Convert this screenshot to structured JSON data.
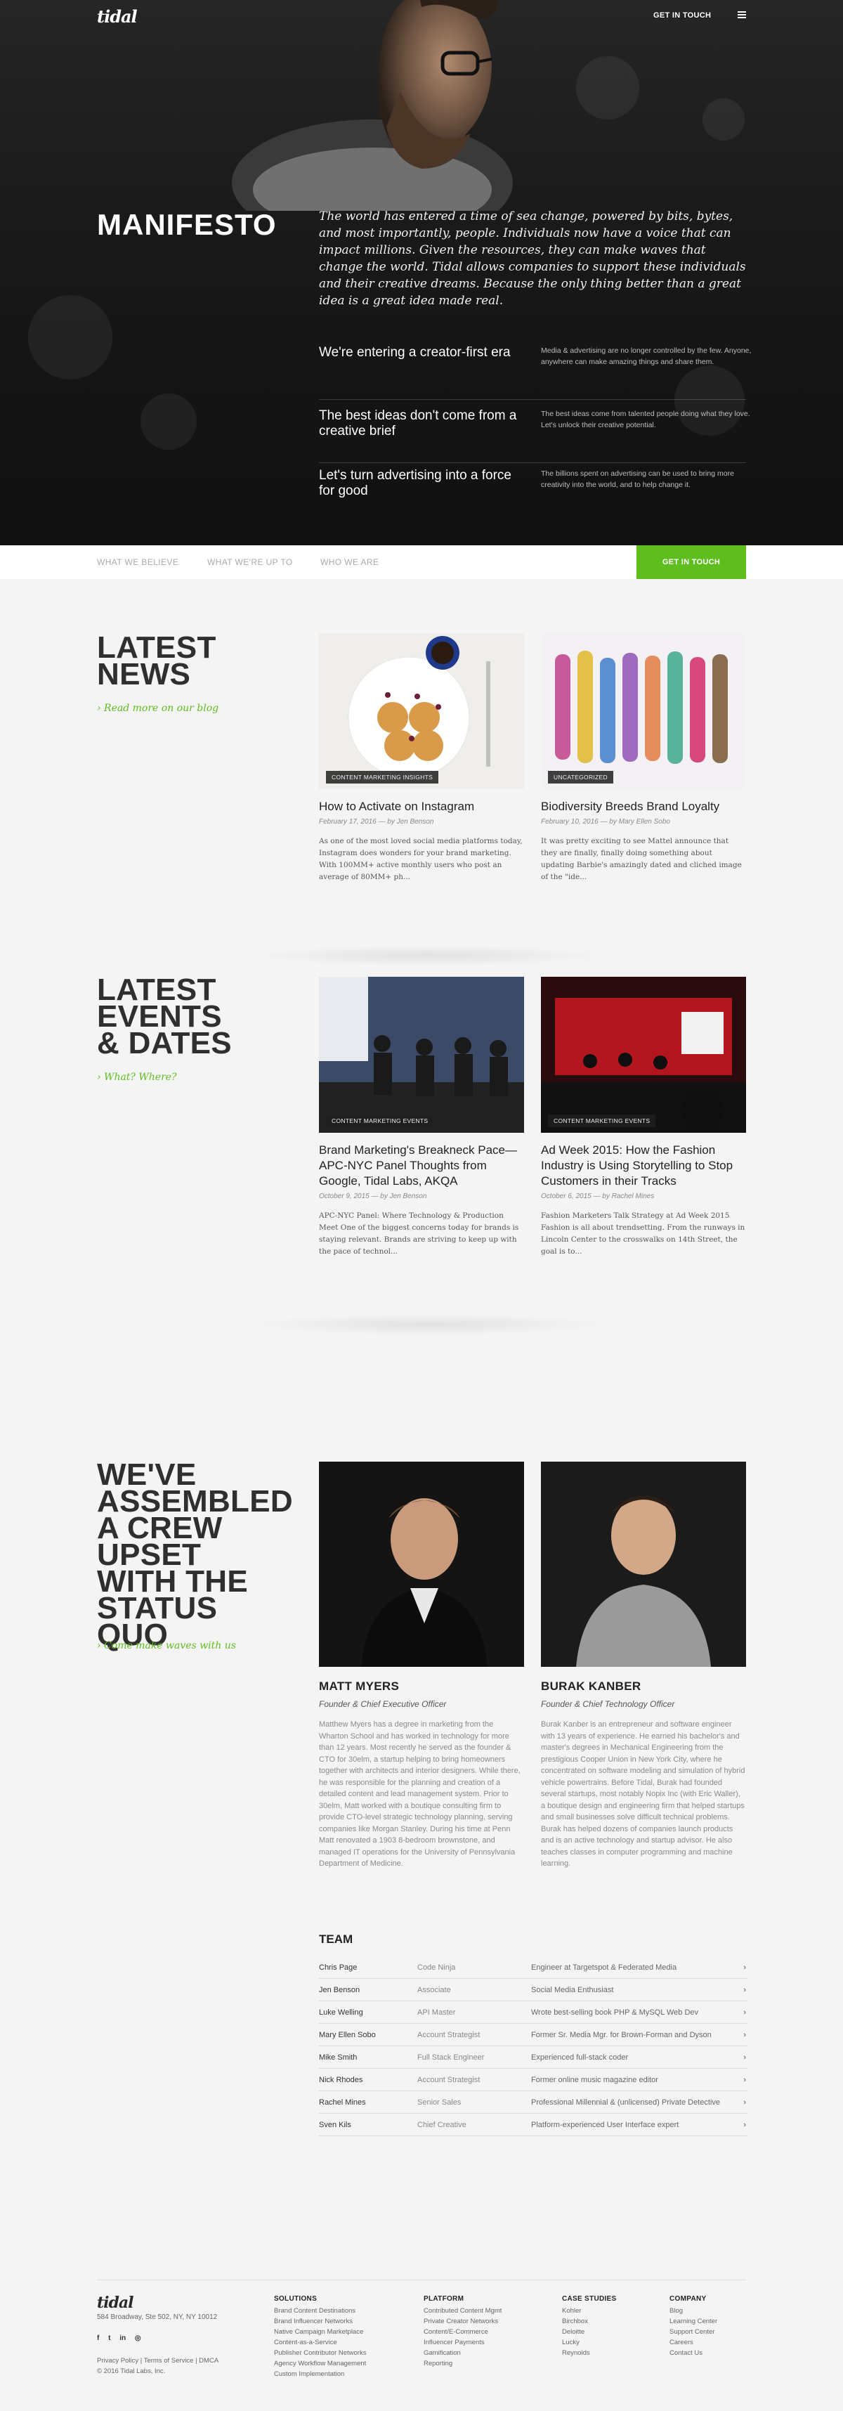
{
  "header": {
    "logo": "tidal",
    "cta": "GET IN TOUCH"
  },
  "manifesto": {
    "title": "MANIFESTO",
    "text": "The world has entered a time of sea change, powered by bits, bytes, and most importantly, people. Individuals now have a voice that can impact millions. Given the resources, they can make waves that change the world. Tidal allows companies to support these individuals and their creative dreams. Because the only thing better than a great idea is a great idea made real.",
    "beliefs": [
      {
        "title": "We're entering a creator-first era",
        "desc": "Media & advertising are no longer controlled by the few. Anyone, anywhere can make amazing things and share them."
      },
      {
        "title": "The best ideas don't come from a creative brief",
        "desc": "The best ideas come from talented people doing what they love. Let's unlock their creative potential."
      },
      {
        "title": "Let's turn advertising into a force for good",
        "desc": "The billions spent on advertising can be used to bring more creativity into the world, and to help change it."
      }
    ]
  },
  "subnav": {
    "items": [
      "WHAT WE BELIEVE",
      "WHAT WE'RE UP TO",
      "WHO WE ARE"
    ],
    "cta": "GET IN TOUCH"
  },
  "news": {
    "title": "LATEST NEWS",
    "link": "› Read more on our blog",
    "cards": [
      {
        "tag": "CONTENT MARKETING INSIGHTS",
        "title": "How to Activate on Instagram",
        "meta": "February 17, 2016 — by Jen Benson",
        "excerpt": "As one of the most loved social media platforms today, Instagram does wonders for your brand marketing. With 100MM+ active monthly users who post an average of 80MM+ ph..."
      },
      {
        "tag": "UNCATEGORIZED",
        "title": "Biodiversity Breeds Brand Loyalty",
        "meta": "February 10, 2016 — by Mary Ellen Sobo",
        "excerpt": "It was pretty exciting to see Mattel announce that they are finally, finally doing something about updating Barbie's amazingly dated and cliched image of the \"ide..."
      }
    ]
  },
  "events": {
    "title": "LATEST EVENTS & DATES",
    "link": "› What? Where?",
    "cards": [
      {
        "tag": "CONTENT MARKETING EVENTS",
        "title": "Brand Marketing's Breakneck Pace— APC-NYC Panel Thoughts from Google, Tidal Labs, AKQA",
        "meta": "October 9, 2015 — by Jen Benson",
        "excerpt": "APC-NYC Panel: Where Technology & Production Meet One of the biggest concerns today for brands is staying relevant. Brands are striving to keep up with the pace of technol..."
      },
      {
        "tag": "CONTENT MARKETING EVENTS",
        "title": "Ad Week 2015: How the Fashion Industry is Using Storytelling to Stop Customers in their Tracks",
        "meta": "October 6, 2015 — by Rachel Mines",
        "excerpt": "Fashion Marketers Talk Strategy at Ad Week 2015 Fashion is all about trendsetting. From the runways in Lincoln Center to the crosswalks on 14th Street, the goal is to..."
      }
    ]
  },
  "crew": {
    "title": "WE'VE ASSEMBLED A CREW UPSET WITH THE STATUS QUO",
    "link": "› Come make waves with us",
    "members": [
      {
        "name": "MATT MYERS",
        "role": "Founder & Chief Executive Officer",
        "bio": "Matthew Myers has a degree in marketing from the Wharton School and has worked in technology for more than 12 years. Most recently he served as the founder & CTO for 30elm, a startup helping to bring homeowners together with architects and interior designers. While there, he was responsible for the planning and creation of a detailed content and lead management system. Prior to 30elm, Matt worked with a boutique consulting firm to provide CTO-level strategic technology planning, serving companies like Morgan Stanley. During his time at Penn Matt renovated a 1903 8-bedroom brownstone, and managed IT operations for the University of Pennsylvania Department of Medicine."
      },
      {
        "name": "BURAK KANBER",
        "role": "Founder & Chief Technology Officer",
        "bio": "Burak Kanber is an entrepreneur and software engineer with 13 years of experience. He earned his bachelor's and master's degrees in Mechanical Engineering from the prestigious Cooper Union in New York City, where he concentrated on software modeling and simulation of hybrid vehicle powertrains. Before Tidal, Burak had founded several startups, most notably Nopix Inc (with Eric Waller), a boutique design and engineering firm that helped startups and small businesses solve difficult technical problems. Burak has helped dozens of companies launch products and is an active technology and startup advisor. He also teaches classes in computer programming and machine learning."
      }
    ]
  },
  "team": {
    "title": "TEAM",
    "rows": [
      {
        "name": "Chris Page",
        "role": "Code Ninja",
        "note": "Engineer at Targetspot & Federated Media"
      },
      {
        "name": "Jen Benson",
        "role": "Associate",
        "note": "Social Media Enthusiast"
      },
      {
        "name": "Luke Welling",
        "role": "API Master",
        "note": "Wrote best-selling book PHP & MySQL Web Dev"
      },
      {
        "name": "Mary Ellen Sobo",
        "role": "Account Strategist",
        "note": "Former Sr. Media Mgr. for Brown-Forman and Dyson"
      },
      {
        "name": "Mike Smith",
        "role": "Full Stack Engineer",
        "note": "Experienced full-stack coder"
      },
      {
        "name": "Nick Rhodes",
        "role": "Account Strategist",
        "note": "Former online music magazine editor"
      },
      {
        "name": "Rachel Mines",
        "role": "Senior Sales",
        "note": "Professional Millennial & (unlicensed) Private Detective"
      },
      {
        "name": "Sven Kils",
        "role": "Chief Creative",
        "note": "Platform-experienced User Interface expert"
      }
    ],
    "arrow": "›"
  },
  "footer": {
    "logo": "tidal",
    "address": "584 Broadway, Ste 502, NY, NY 10012",
    "social": [
      "f",
      "t",
      "in",
      "◎"
    ],
    "legal1": "Privacy Policy | Terms of Service | DMCA",
    "legal2": "© 2016 Tidal Labs, Inc.",
    "columns": [
      {
        "title": "SOLUTIONS",
        "links": [
          "Brand Content Destinations",
          "Brand Influencer Networks",
          "Native Campaign Marketplace",
          "Content-as-a-Service",
          "Publisher Contributor Networks",
          "Agency Workflow Management",
          "Custom Implementation"
        ]
      },
      {
        "title": "PLATFORM",
        "links": [
          "Contributed Content Mgmt",
          "Private Creator Networks",
          "Content/E-Commerce",
          "Influencer Payments",
          "Gamification",
          "Reporting"
        ]
      },
      {
        "title": "CASE STUDIES",
        "links": [
          "Kohler",
          "Birchbox",
          "Deloitte",
          "Lucky",
          "Reynolds"
        ]
      },
      {
        "title": "COMPANY",
        "links": [
          "Blog",
          "Learning Center",
          "Support Center",
          "Careers",
          "Contact Us"
        ]
      }
    ]
  }
}
